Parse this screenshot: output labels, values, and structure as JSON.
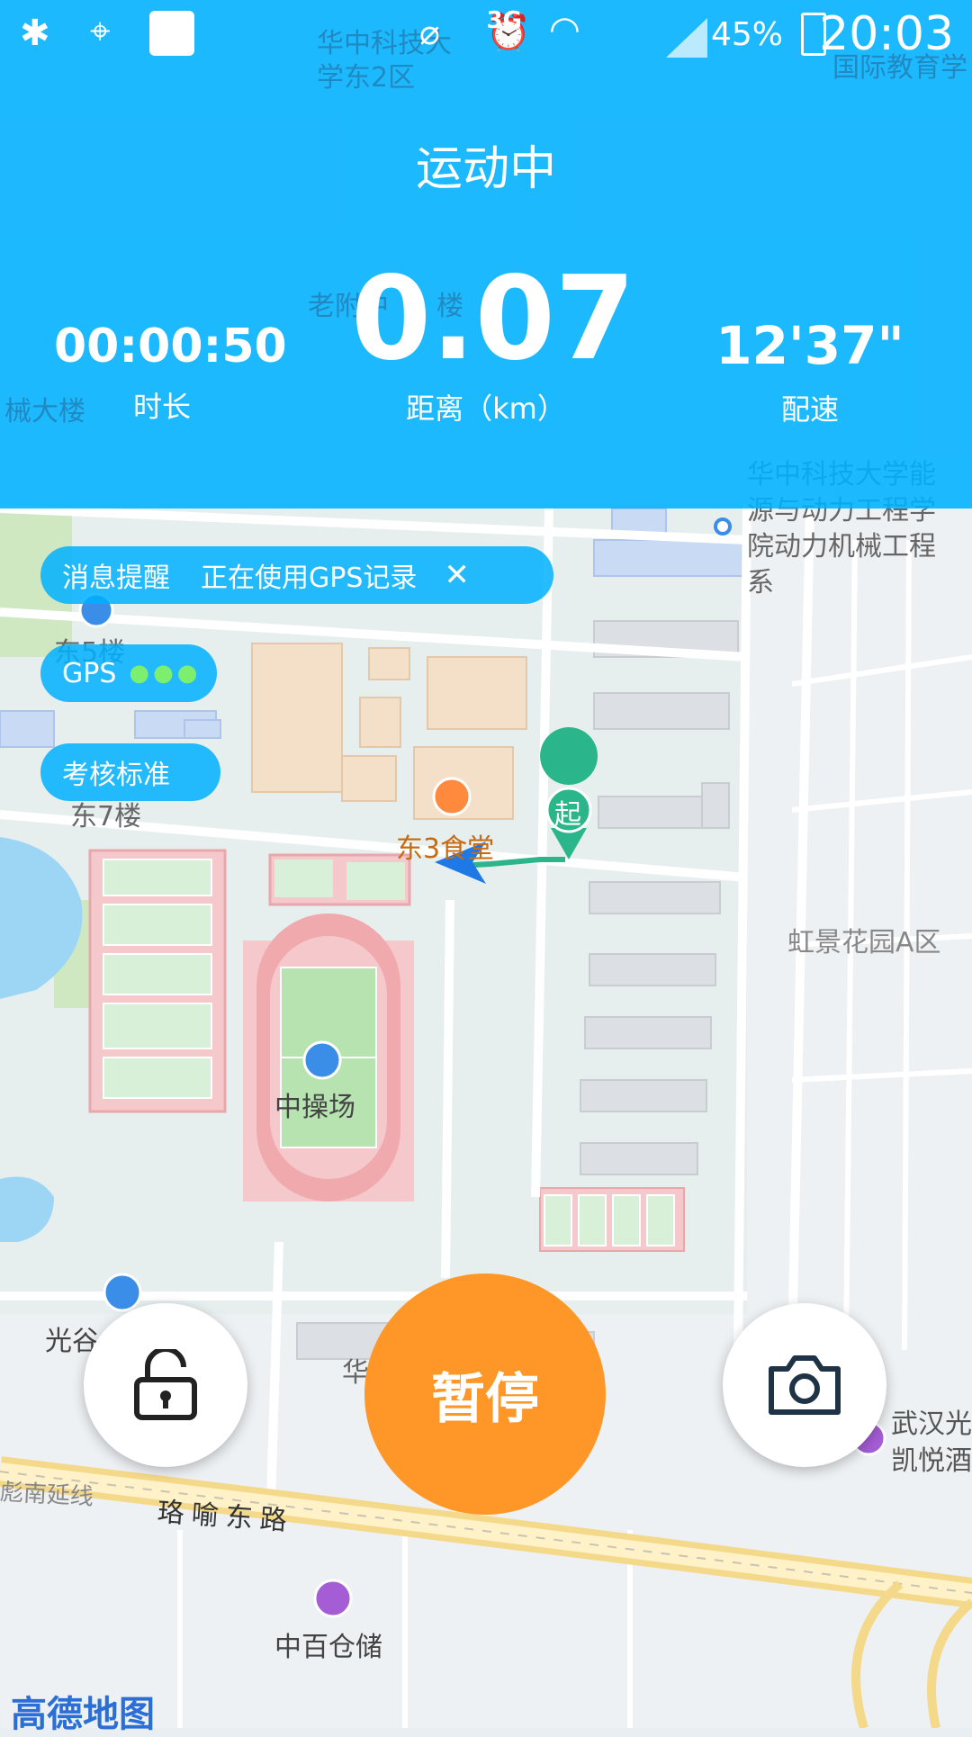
{
  "status_bar": {
    "network": "3G",
    "battery": "45%",
    "time": "20:03"
  },
  "header": {
    "title": "运动中",
    "duration": {
      "value": "00:00:50",
      "label": "时长"
    },
    "distance": {
      "value": "0.07",
      "label": "距离（km）"
    },
    "pace": {
      "value": "12'37\"",
      "label": "配速"
    }
  },
  "pills": {
    "notice": {
      "title": "消息提醒",
      "text": "正在使用GPS记录"
    },
    "gps": {
      "label": "GPS"
    },
    "standard": {
      "label": "考核标准"
    }
  },
  "map_labels": {
    "east2": "华中科技大学东2区",
    "laofu": "老附中",
    "lou": "楼",
    "intl": "国际教育学",
    "mech": "械大楼",
    "energy": "华中科技大学能源与动力工程学院动力机械工程系",
    "east5": "东5楼",
    "east7": "东7楼",
    "canteen": "东3食堂",
    "start": "起",
    "field": "中操场",
    "hongjing": "虹景花园A区",
    "guanggu": "光谷",
    "hua": "华",
    "hotel1": "武汉光",
    "hotel2": "凯悦酒",
    "line": "彪南延线",
    "road": "珞喻东路",
    "zhongbai": "中百仓储"
  },
  "controls": {
    "pause": "暂停"
  },
  "attribution": "高德地图",
  "colors": {
    "header": "#00b0ff",
    "pause": "#ff9728",
    "track": "#2bb58a"
  }
}
